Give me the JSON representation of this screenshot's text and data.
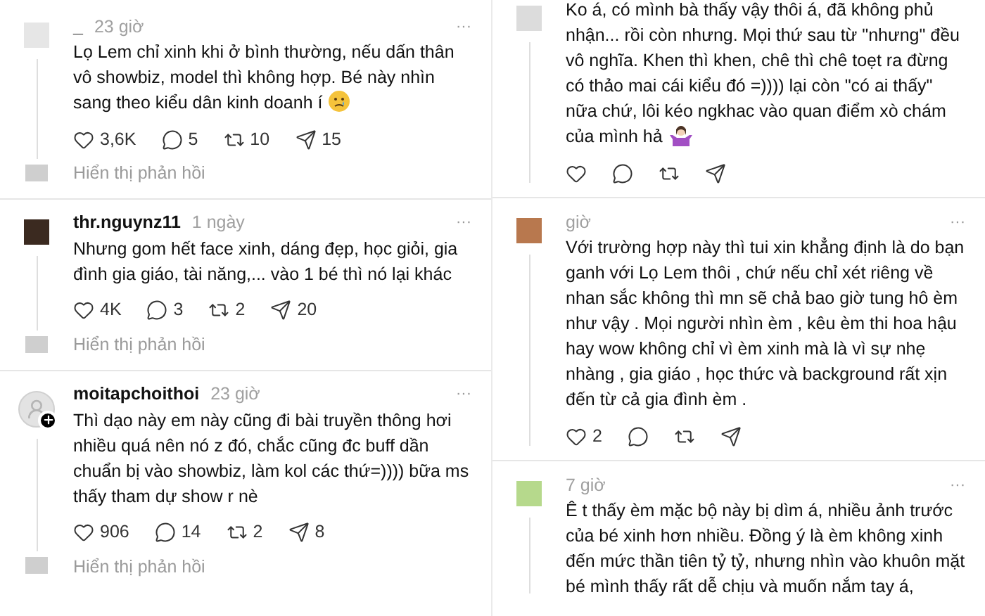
{
  "columns": [
    {
      "comments": [
        {
          "kind": "photo",
          "color": "#e6e6e6",
          "username": "_",
          "time": "23 giờ",
          "more": "···",
          "text": "Lọ Lem chỉ xinh khi ở bình thường, nếu dấn thân vô showbiz, model thì không hợp. Bé này nhìn sang theo kiểu dân kinh doanh í",
          "emoji": {
            "kind": "crying"
          },
          "stats": [
            {
              "kind": "like",
              "count": "3,6K"
            },
            {
              "kind": "reply",
              "count": "5"
            },
            {
              "kind": "repost",
              "count": "10"
            },
            {
              "kind": "share",
              "count": "15"
            }
          ],
          "show_replies": "Hiển thị phản hồi"
        },
        {
          "kind": "photo",
          "color": "#3b2a20",
          "username": "thr.nguynz11",
          "time": "1 ngày",
          "more": "···",
          "text": "Nhưng gom hết face xinh, dáng đẹp, học giỏi, gia đình gia giáo, tài năng,... vào 1 bé thì nó lại khác",
          "stats": [
            {
              "kind": "like",
              "count": "4K"
            },
            {
              "kind": "reply",
              "count": "3"
            },
            {
              "kind": "repost",
              "count": "2"
            },
            {
              "kind": "share",
              "count": "20"
            }
          ],
          "show_replies": "Hiển thị phản hồi"
        },
        {
          "kind": "default",
          "color": "#e3e3e3",
          "username": "moitapchoithoi",
          "time": "23 giờ",
          "more": "···",
          "text": "Thì dạo này em này cũng đi bài truyền thông hơi nhiều quá nên nó z đó, chắc cũng đc buff dần chuẩn bị vào showbiz, làm kol các thứ=)))) bữa ms thấy tham dự show r nè",
          "stats": [
            {
              "kind": "like",
              "count": "906"
            },
            {
              "kind": "reply",
              "count": "14"
            },
            {
              "kind": "repost",
              "count": "2"
            },
            {
              "kind": "share",
              "count": "8"
            }
          ],
          "show_replies": "Hiển thị phản hồi"
        }
      ]
    },
    {
      "comments": [
        {
          "kind": "photo",
          "color": "#dcdcdc",
          "text": "Ko á, có mình bà thấy vậy thôi á, đã không phủ nhận... rồi còn nhưng. Mọi thứ sau từ \"nhưng\" đều vô nghĩa. Khen thì khen, chê thì chê toẹt ra đừng có thảo mai cái kiểu đó =)))) lại còn \"có ai thấy\" nữa chứ, lôi kéo ngkhac vào quan điểm xò chám của mình hả",
          "emoji": {
            "kind": "shrug"
          },
          "stats": [
            {
              "kind": "like"
            },
            {
              "kind": "reply"
            },
            {
              "kind": "repost"
            },
            {
              "kind": "share"
            }
          ]
        },
        {
          "kind": "photo",
          "color": "#b8784e",
          "time": "giờ",
          "more": "···",
          "text": "Với trường hợp này thì tui xin khẳng định là do bạn ganh với Lọ Lem thôi , chứ nếu chỉ xét riêng về nhan sắc không thì mn sẽ chả bao giờ tung hô èm như vậy . Mọi người nhìn èm , kêu èm thi hoa hậu hay wow không chỉ vì èm xinh mà là vì sự nhẹ nhàng , gia giáo , học thức và background rất xịn đến từ cả gia đình èm .",
          "stats": [
            {
              "kind": "like",
              "count": "2"
            },
            {
              "kind": "reply"
            },
            {
              "kind": "repost"
            },
            {
              "kind": "share"
            }
          ]
        },
        {
          "kind": "photo",
          "color": "#b6d98c",
          "time": "7 giờ",
          "more": "···",
          "text": "Ê t thấy èm mặc bộ này bị dìm á, nhiều ảnh trước của bé xinh hơn nhiều. Đồng ý là èm không xinh đến mức thần tiên tỷ tỷ, nhưng nhìn vào khuôn mặt bé mình thấy rất dễ chịu và muốn nắm tay á,"
        }
      ]
    }
  ]
}
